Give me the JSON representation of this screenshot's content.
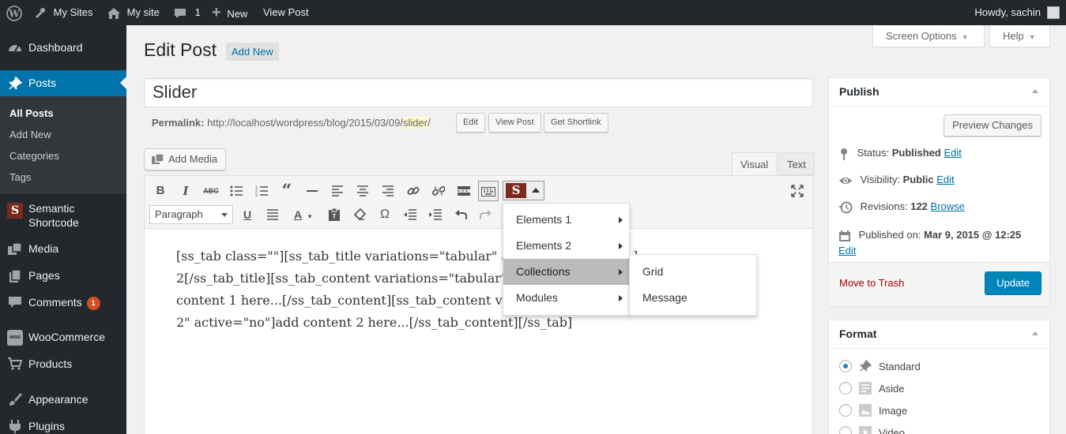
{
  "admin_bar": {
    "my_sites": "My Sites",
    "site_name": "My site",
    "comments_count": "1",
    "new_label": "New",
    "view_post": "View Post",
    "howdy": "Howdy, sachin"
  },
  "sidebar": {
    "dashboard": "Dashboard",
    "posts": "Posts",
    "posts_submenu": [
      "All Posts",
      "Add New",
      "Categories",
      "Tags"
    ],
    "semantic_shortcode": "Semantic Shortcode",
    "media": "Media",
    "pages": "Pages",
    "comments": "Comments",
    "comments_badge": "1",
    "woocommerce": "WooCommerce",
    "products": "Products",
    "appearance": "Appearance",
    "plugins": "Plugins"
  },
  "screen_options": "Screen Options",
  "help": "Help",
  "page_title": "Edit Post",
  "add_new": "Add New",
  "post": {
    "title": "Slider",
    "permalink_label": "Permalink:",
    "permalink_base": "http://localhost/wordpress/blog/2015/03/09/",
    "permalink_slug": "slider",
    "permalink_end": "/",
    "edit_btn": "Edit",
    "view_post_btn": "View Post",
    "get_shortlink_btn": "Get Shortlink"
  },
  "editor": {
    "add_media": "Add Media",
    "tab_visual": "Visual",
    "tab_text": "Text",
    "format_select": "Paragraph",
    "content_lines": [
      "[ss_tab class=\"\"][ss_tab_title variations=\"tabular\" ac",
      "2[/ss_tab_title][ss_tab_content variations=\"tabular\"",
      "content 1 here...[/ss_tab_content][ss_tab_content va",
      "2\" active=\"no\"]add content 2 here...[/ss_tab_content][/ss_tab]"
    ],
    "content_fragment_right": "]"
  },
  "shortcode_menu": {
    "items": [
      "Elements 1",
      "Elements 2",
      "Collections",
      "Modules"
    ],
    "highlighted": "Collections",
    "submenu": [
      "Grid",
      "Message"
    ]
  },
  "publish": {
    "title": "Publish",
    "preview_btn": "Preview Changes",
    "status_label": "Status:",
    "status_value": "Published",
    "visibility_label": "Visibility:",
    "visibility_value": "Public",
    "revisions_label": "Revisions:",
    "revisions_count": "122",
    "browse": "Browse",
    "published_on_label": "Published on:",
    "published_on_value": "Mar 9, 2015 @ 12:25",
    "edit": "Edit",
    "move_to_trash": "Move to Trash",
    "update": "Update"
  },
  "format": {
    "title": "Format",
    "options": [
      "Standard",
      "Aside",
      "Image",
      "Video"
    ],
    "selected": "Standard"
  },
  "colors": {
    "admin_bar_bg": "#23282d",
    "active_menu": "#0073aa",
    "primary_button": "#0085ba",
    "badge": "#d54e21"
  }
}
